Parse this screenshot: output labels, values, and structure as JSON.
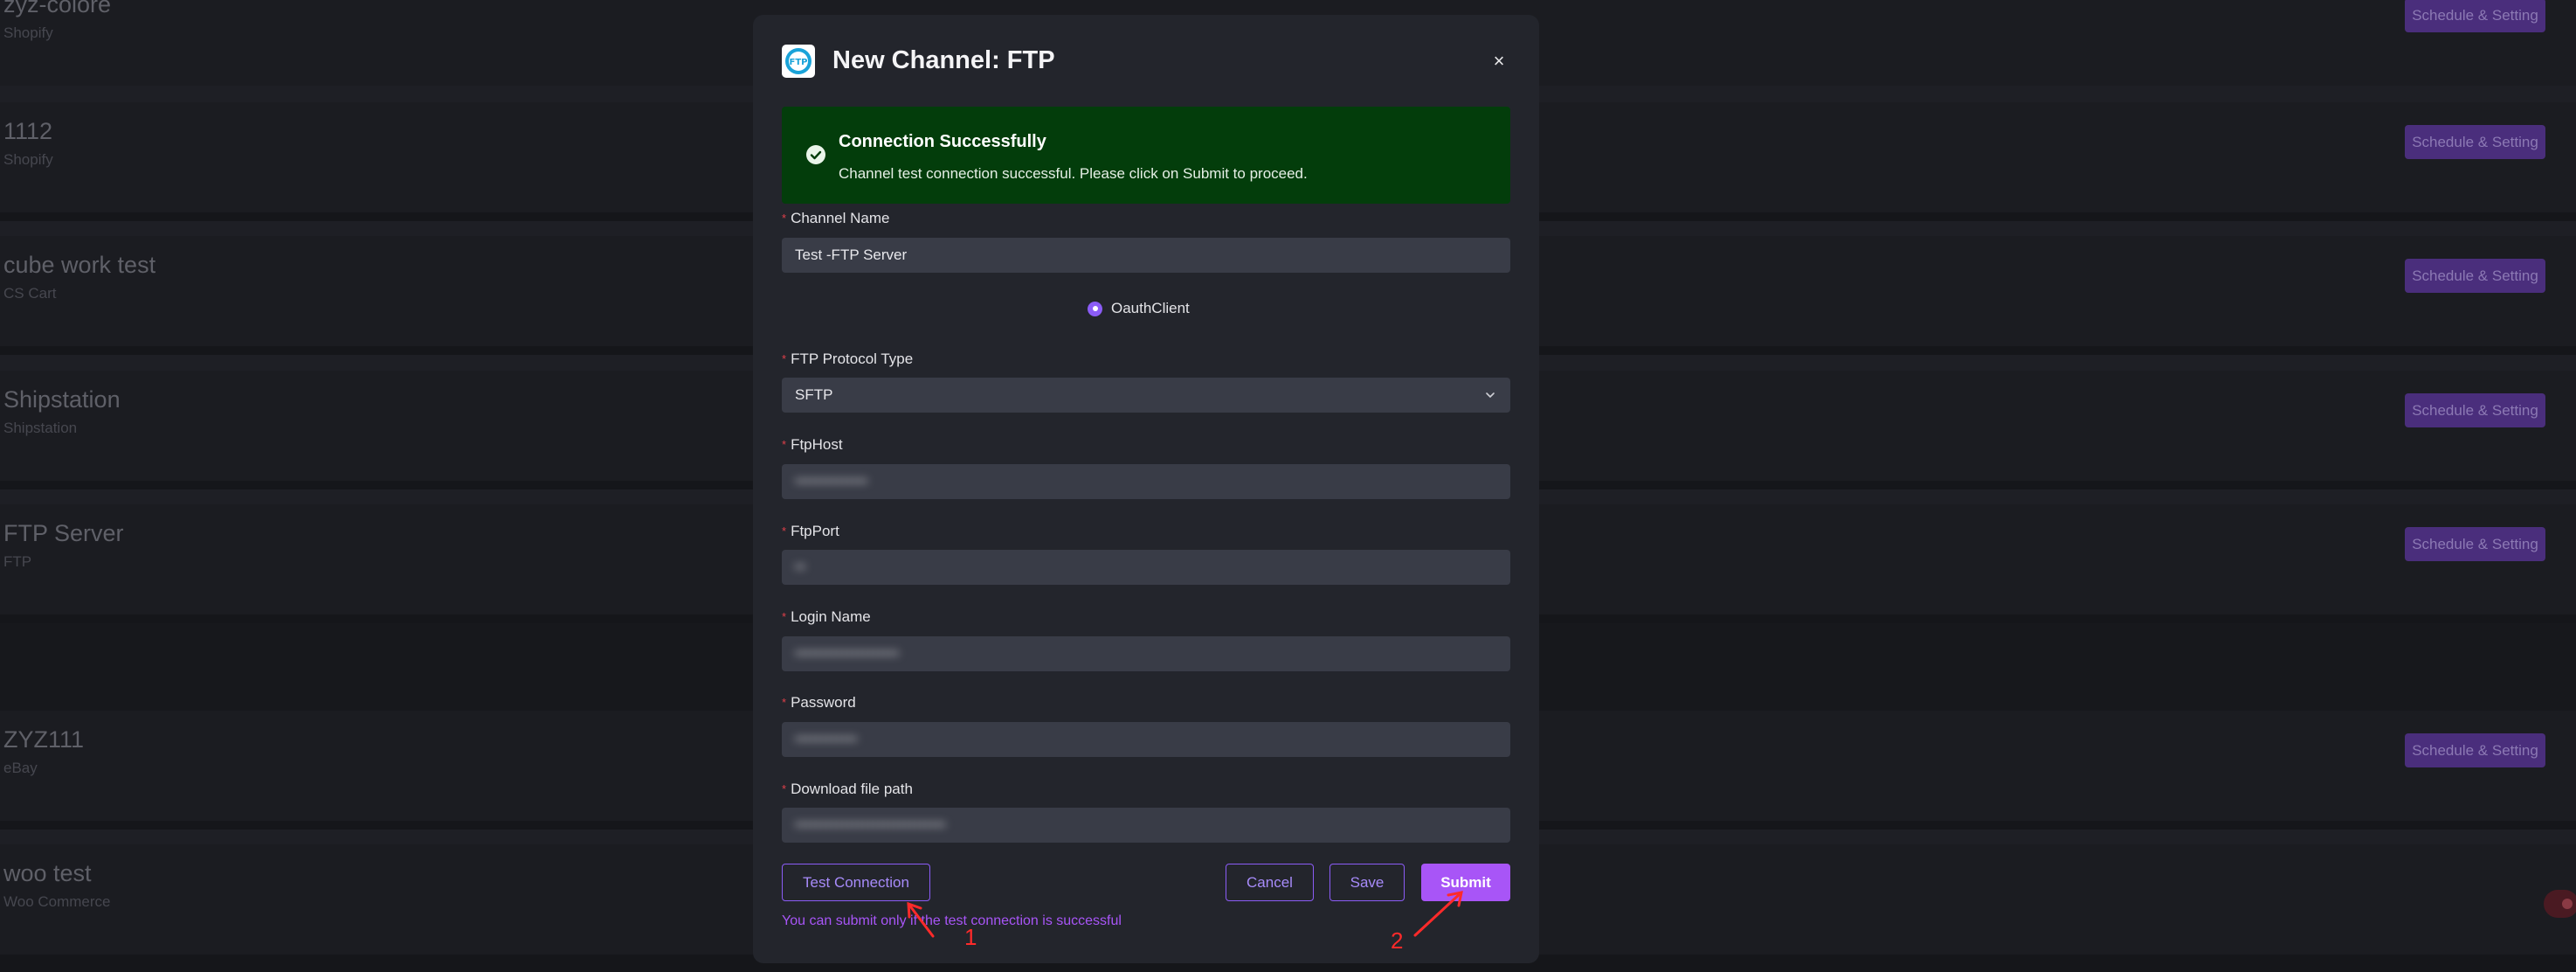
{
  "background_channels": [
    {
      "name": "zyz-colore",
      "platform": "Shopify",
      "button": "Schedule & Setting"
    },
    {
      "name": "1112",
      "platform": "Shopify",
      "button": "Schedule & Setting"
    },
    {
      "name": "cube work test",
      "platform": "CS Cart",
      "button": "Schedule & Setting"
    },
    {
      "name": "Shipstation",
      "platform": "Shipstation",
      "button": "Schedule & Setting"
    },
    {
      "name": "FTP Server",
      "platform": "FTP",
      "button": "Schedule & Setting"
    },
    {
      "name": "ZYZ111",
      "platform": "eBay",
      "button": "Schedule & Setting"
    },
    {
      "name": "woo test",
      "platform": "Woo Commerce",
      "button": ""
    }
  ],
  "modal": {
    "logo_icon": "ftp-logo-icon",
    "logo_text": "FTP",
    "title": "New Channel: FTP",
    "close_symbol": "×",
    "alert": {
      "icon": "check-circle-icon",
      "title": "Connection Successfully",
      "message": "Channel test connection successful. Please click on Submit to proceed."
    },
    "fields": {
      "channel_name": {
        "label": "Channel Name",
        "value": "Test -FTP Server"
      },
      "radio": {
        "label": "OauthClient",
        "selected": true
      },
      "protocol": {
        "label": "FTP Protocol Type",
        "value": "SFTP"
      },
      "host": {
        "label": "FtpHost",
        "value": "••••••••••••••"
      },
      "port": {
        "label": "FtpPort",
        "value": "••"
      },
      "login": {
        "label": "Login Name",
        "value": "••••••••••••••••••••"
      },
      "password": {
        "label": "Password",
        "value": "••••••••••••"
      },
      "download_path": {
        "label": "Download file path",
        "value": "•••••••••••••••••••••••••••••"
      }
    },
    "required_mark": "*",
    "buttons": {
      "test": "Test Connection",
      "cancel": "Cancel",
      "save": "Save",
      "submit": "Submit"
    },
    "hint": "You can submit only if the test connection is successful"
  },
  "annotations": {
    "label_1": "1",
    "label_2": "2",
    "color": "#ff2a2a"
  },
  "colors": {
    "accent": "#a855f7",
    "success_bg": "#033d0b",
    "modal_bg": "#23252c",
    "input_bg": "#393c47"
  }
}
